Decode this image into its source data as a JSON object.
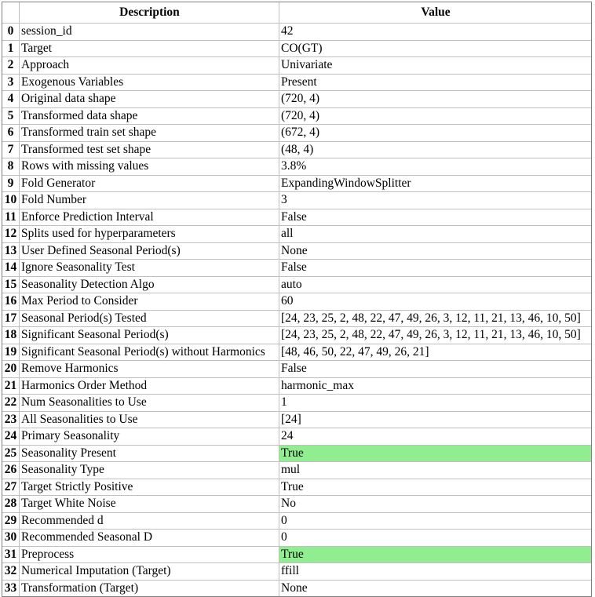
{
  "table": {
    "name": "setup-summary-dataframe",
    "columns": {
      "index_header": "",
      "description": "Description",
      "value": "Value"
    },
    "highlight_color": "#90ee90",
    "rows": [
      {
        "index": "0",
        "description": "session_id",
        "value": "42",
        "highlight": false
      },
      {
        "index": "1",
        "description": "Target",
        "value": "CO(GT)",
        "highlight": false
      },
      {
        "index": "2",
        "description": "Approach",
        "value": "Univariate",
        "highlight": false
      },
      {
        "index": "3",
        "description": "Exogenous Variables",
        "value": "Present",
        "highlight": false
      },
      {
        "index": "4",
        "description": "Original data shape",
        "value": "(720, 4)",
        "highlight": false
      },
      {
        "index": "5",
        "description": "Transformed data shape",
        "value": "(720, 4)",
        "highlight": false
      },
      {
        "index": "6",
        "description": "Transformed train set shape",
        "value": "(672, 4)",
        "highlight": false
      },
      {
        "index": "7",
        "description": "Transformed test set shape",
        "value": "(48, 4)",
        "highlight": false
      },
      {
        "index": "8",
        "description": "Rows with missing values",
        "value": "3.8%",
        "highlight": false
      },
      {
        "index": "9",
        "description": "Fold Generator",
        "value": "ExpandingWindowSplitter",
        "highlight": false
      },
      {
        "index": "10",
        "description": "Fold Number",
        "value": "3",
        "highlight": false
      },
      {
        "index": "11",
        "description": "Enforce Prediction Interval",
        "value": "False",
        "highlight": false
      },
      {
        "index": "12",
        "description": "Splits used for hyperparameters",
        "value": "all",
        "highlight": false
      },
      {
        "index": "13",
        "description": "User Defined Seasonal Period(s)",
        "value": "None",
        "highlight": false
      },
      {
        "index": "14",
        "description": "Ignore Seasonality Test",
        "value": "False",
        "highlight": false
      },
      {
        "index": "15",
        "description": "Seasonality Detection Algo",
        "value": "auto",
        "highlight": false
      },
      {
        "index": "16",
        "description": "Max Period to Consider",
        "value": "60",
        "highlight": false
      },
      {
        "index": "17",
        "description": "Seasonal Period(s) Tested",
        "value": "[24, 23, 25, 2, 48, 22, 47, 49, 26, 3, 12, 11, 21, 13, 46, 10, 50]",
        "highlight": false
      },
      {
        "index": "18",
        "description": "Significant Seasonal Period(s)",
        "value": "[24, 23, 25, 2, 48, 22, 47, 49, 26, 3, 12, 11, 21, 13, 46, 10, 50]",
        "highlight": false
      },
      {
        "index": "19",
        "description": "Significant Seasonal Period(s) without Harmonics",
        "value": "[48, 46, 50, 22, 47, 49, 26, 21]",
        "highlight": false
      },
      {
        "index": "20",
        "description": "Remove Harmonics",
        "value": "False",
        "highlight": false
      },
      {
        "index": "21",
        "description": "Harmonics Order Method",
        "value": "harmonic_max",
        "highlight": false
      },
      {
        "index": "22",
        "description": "Num Seasonalities to Use",
        "value": "1",
        "highlight": false
      },
      {
        "index": "23",
        "description": "All Seasonalities to Use",
        "value": "[24]",
        "highlight": false
      },
      {
        "index": "24",
        "description": "Primary Seasonality",
        "value": "24",
        "highlight": false
      },
      {
        "index": "25",
        "description": "Seasonality Present",
        "value": "True",
        "highlight": true
      },
      {
        "index": "26",
        "description": "Seasonality Type",
        "value": "mul",
        "highlight": false
      },
      {
        "index": "27",
        "description": "Target Strictly Positive",
        "value": "True",
        "highlight": false
      },
      {
        "index": "28",
        "description": "Target White Noise",
        "value": "No",
        "highlight": false
      },
      {
        "index": "29",
        "description": "Recommended d",
        "value": "0",
        "highlight": false
      },
      {
        "index": "30",
        "description": "Recommended Seasonal D",
        "value": "0",
        "highlight": false
      },
      {
        "index": "31",
        "description": "Preprocess",
        "value": "True",
        "highlight": true
      },
      {
        "index": "32",
        "description": "Numerical Imputation (Target)",
        "value": "ffill",
        "highlight": false
      },
      {
        "index": "33",
        "description": "Transformation (Target)",
        "value": "None",
        "highlight": false
      }
    ]
  }
}
